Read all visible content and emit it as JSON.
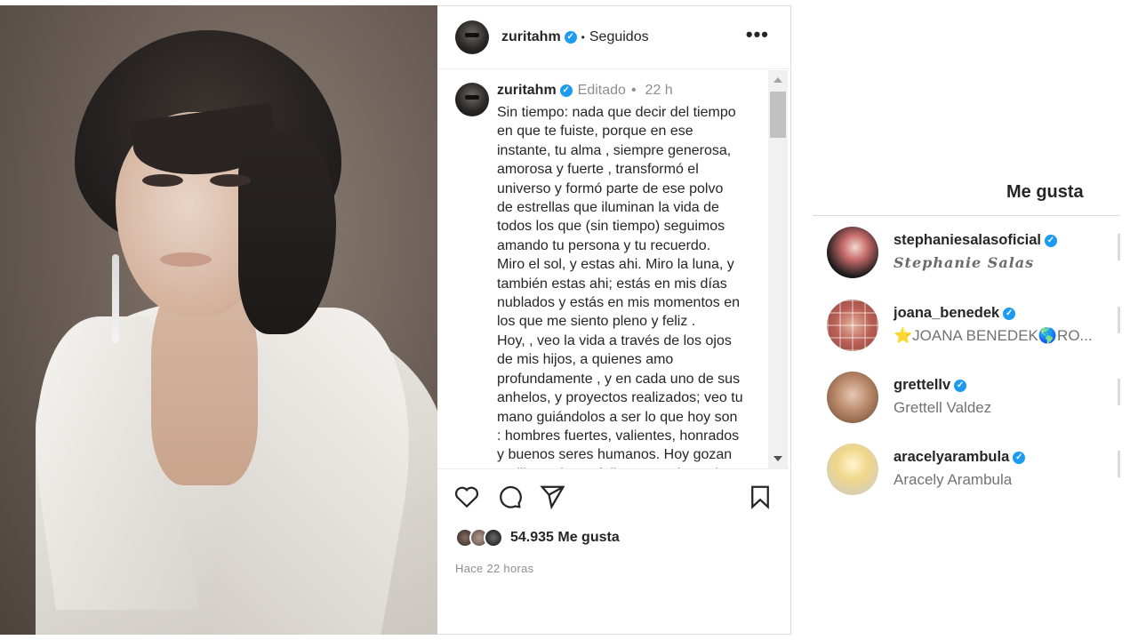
{
  "post": {
    "username": "zuritahm",
    "follow_status": "Seguidos",
    "more_icon": "more-horizontal-icon",
    "caption": {
      "username": "zuritahm",
      "edited_label": "Editado",
      "time": "22 h",
      "text": "Sin tiempo: nada que decir del tiempo\nen que te fuiste, porque en ese\ninstante, tu alma , siempre generosa,\namorosa y fuerte , transformó el\nuniverso y formó parte de ese polvo\nde estrellas que iluminan la vida de\ntodos los que (sin tiempo) seguimos\namando tu persona y tu recuerdo.\nMiro el sol, y estas ahi. Miro la luna, y\ntambién estas ahi; estás en mis días\nnublados y estás en mis momentos en\nlos que me siento pleno y feliz .\nHoy, , veo la vida a través de los ojos\nde mis hijos, a quienes amo\nprofundamente , y en cada uno de sus\nanhelos, y proyectos realizados; veo tu\nmano guiándolos a ser lo que hoy son\n: hombres fuertes, valientes, honrados\ny buenos seres humanos. Hoy gozan\nen libertad, son felices. Gracias, mi"
    },
    "likes_count": "54.935 Me gusta",
    "time_ago": "Hace 22 horas"
  },
  "likes_panel": {
    "title": "Me gusta",
    "likers": [
      {
        "username": "stephaniesalasoficial",
        "name": "Stephanie Salas",
        "verified": true
      },
      {
        "username": "joana_benedek",
        "name": "⭐JOANA BENEDEK🌎RO...",
        "verified": true
      },
      {
        "username": "grettellv",
        "name": "Grettell Valdez",
        "verified": true
      },
      {
        "username": "aracelyarambula",
        "name": "Aracely Arambula",
        "verified": true
      }
    ]
  },
  "colors": {
    "verified": "#1d9bf0",
    "text": "#262626",
    "muted": "#8e8e8e",
    "border": "#dbdbdb"
  }
}
